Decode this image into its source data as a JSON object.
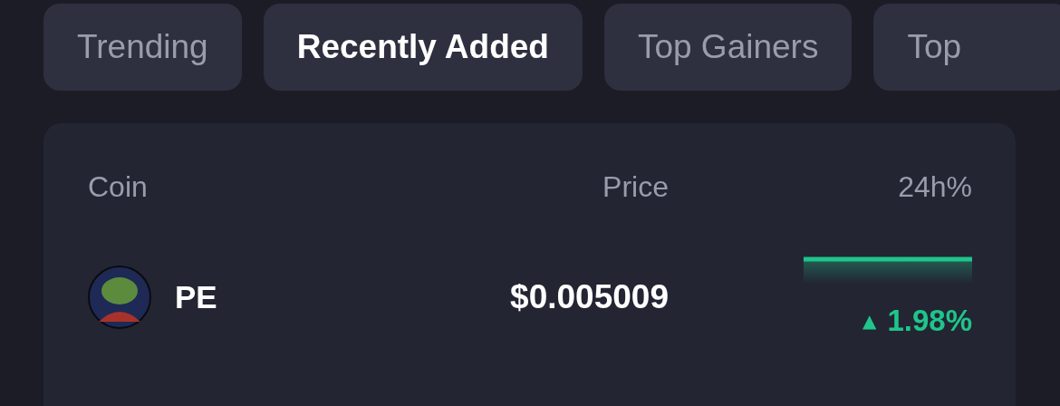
{
  "tabs": [
    {
      "label": "Trending",
      "selected": false
    },
    {
      "label": "Recently Added",
      "selected": true
    },
    {
      "label": "Top Gainers",
      "selected": false
    },
    {
      "label": "Top",
      "selected": false
    }
  ],
  "table": {
    "columns": [
      "Coin",
      "Price",
      "24h%"
    ],
    "rows": [
      {
        "coin": "PE",
        "price": "$0.005009",
        "arrow": "▲",
        "change": "1.98%"
      }
    ]
  }
}
